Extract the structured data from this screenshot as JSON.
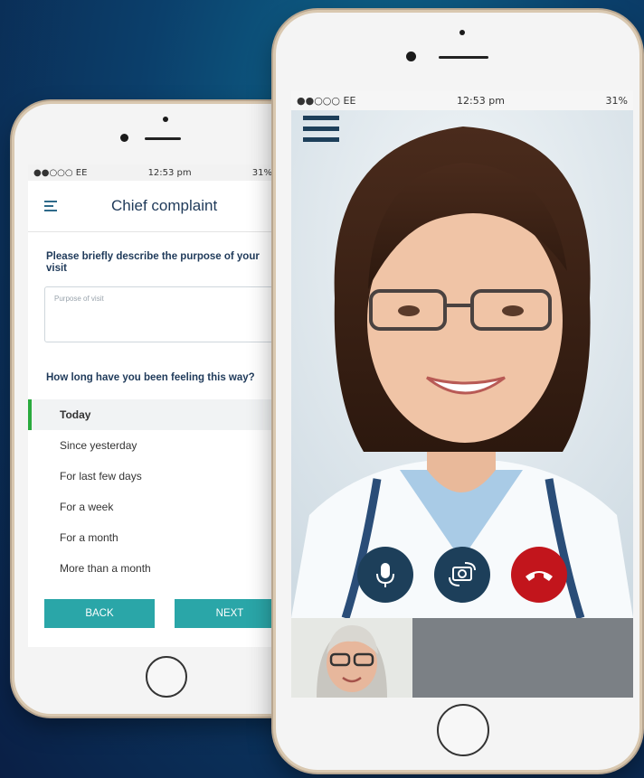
{
  "left_phone": {
    "status": {
      "carrier": "●●○○○ EE",
      "time": "12:53 pm",
      "battery": "31%"
    },
    "header_title": "Chief complaint",
    "question1": "Please briefly describe the purpose of your visit",
    "purpose_placeholder": "Purpose of visit",
    "question2": "How long have you been feeling this way?",
    "options": [
      "Today",
      "Since yesterday",
      "For last few days",
      "For a week",
      "For a month",
      "More than a month"
    ],
    "selected_option": "Today",
    "back_label": "BACK",
    "next_label": "NEXT"
  },
  "right_phone": {
    "status": {
      "carrier": "●●○○○ EE",
      "time": "12:53 pm",
      "battery": "31%"
    },
    "controls": [
      "microphone-icon",
      "switch-camera-icon",
      "end-call-icon"
    ]
  },
  "colors": {
    "accent": "#2aa6a8",
    "selected": "#2aaa3e",
    "end_call": "#c2151c",
    "control": "#1d3f5a"
  }
}
